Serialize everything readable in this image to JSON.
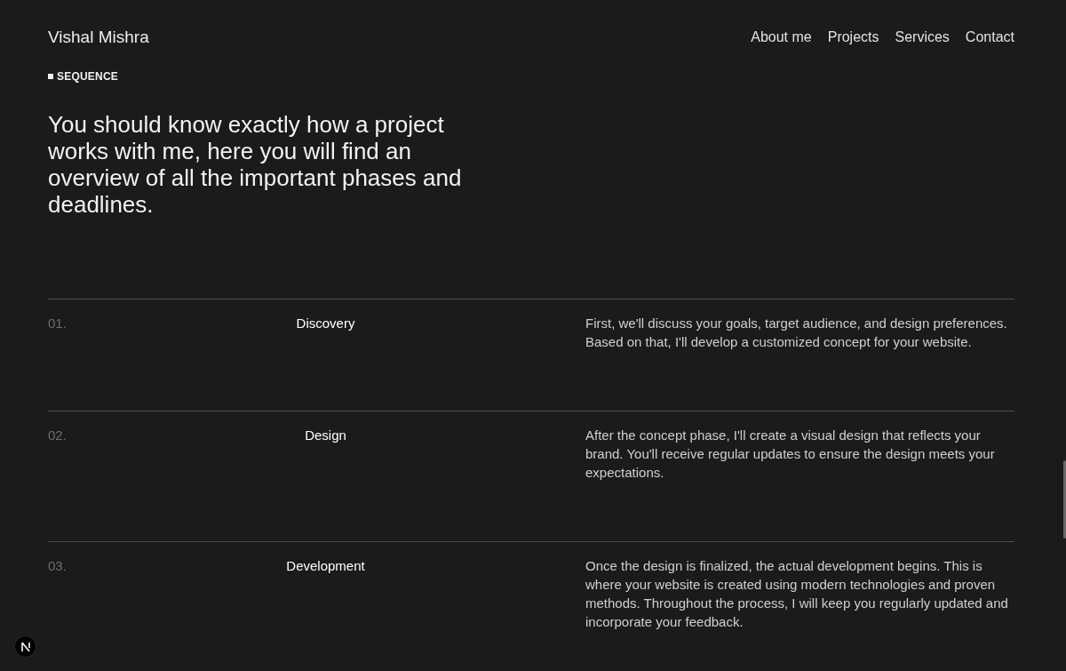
{
  "header": {
    "name": "Vishal Mishra",
    "nav": [
      "About me",
      "Projects",
      "Services",
      "Contact"
    ]
  },
  "section": {
    "label": "SEQUENCE",
    "heading": "You should know exactly how a project works with me, here you will find an overview of all the important phases and deadlines.",
    "steps": [
      {
        "number": "01.",
        "title": "Discovery",
        "description": "First, we'll discuss your goals, target audience, and design preferences. Based on that, I'll develop a customized concept for your website."
      },
      {
        "number": "02.",
        "title": "Design",
        "description": "After the concept phase, I'll create a visual design that reflects your brand. You'll receive regular updates to ensure the design meets your expectations."
      },
      {
        "number": "03.",
        "title": "Development",
        "description": "Once the design is finalized, the actual development begins. This is where your website is created using modern technologies and proven methods. Throughout the process, I will keep you regularly updated and incorporate your feedback."
      }
    ]
  }
}
